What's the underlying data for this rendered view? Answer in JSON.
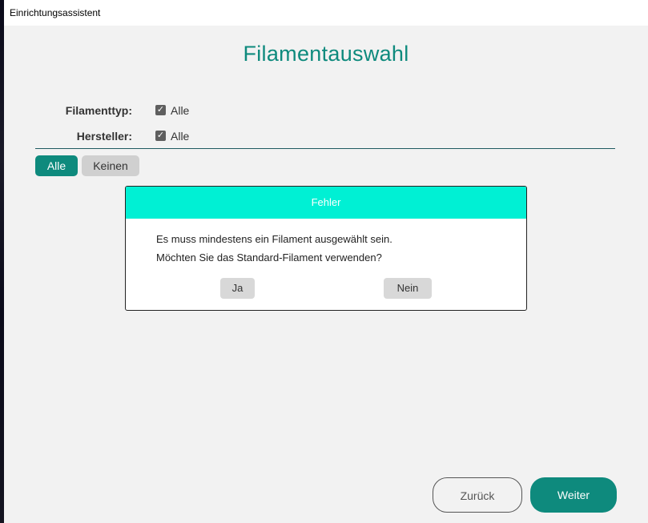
{
  "window": {
    "title": "Einrichtungsassistent"
  },
  "page": {
    "title": "Filamentauswahl"
  },
  "filters": [
    {
      "label": "Filamenttyp:",
      "option": "Alle",
      "checked": true
    },
    {
      "label": "Hersteller:",
      "option": "Alle",
      "checked": true
    }
  ],
  "selection_buttons": {
    "all": "Alle",
    "none": "Keinen"
  },
  "dialog": {
    "title": "Fehler",
    "line1": "Es muss mindestens ein Filament ausgewählt sein.",
    "line2": "Möchten Sie das Standard-Filament verwenden?",
    "yes": "Ja",
    "no": "Nein"
  },
  "navigation": {
    "back": "Zurück",
    "next": "Weiter"
  },
  "colors": {
    "accent": "#0e8a7d",
    "dialog_header": "#00f0d4"
  }
}
